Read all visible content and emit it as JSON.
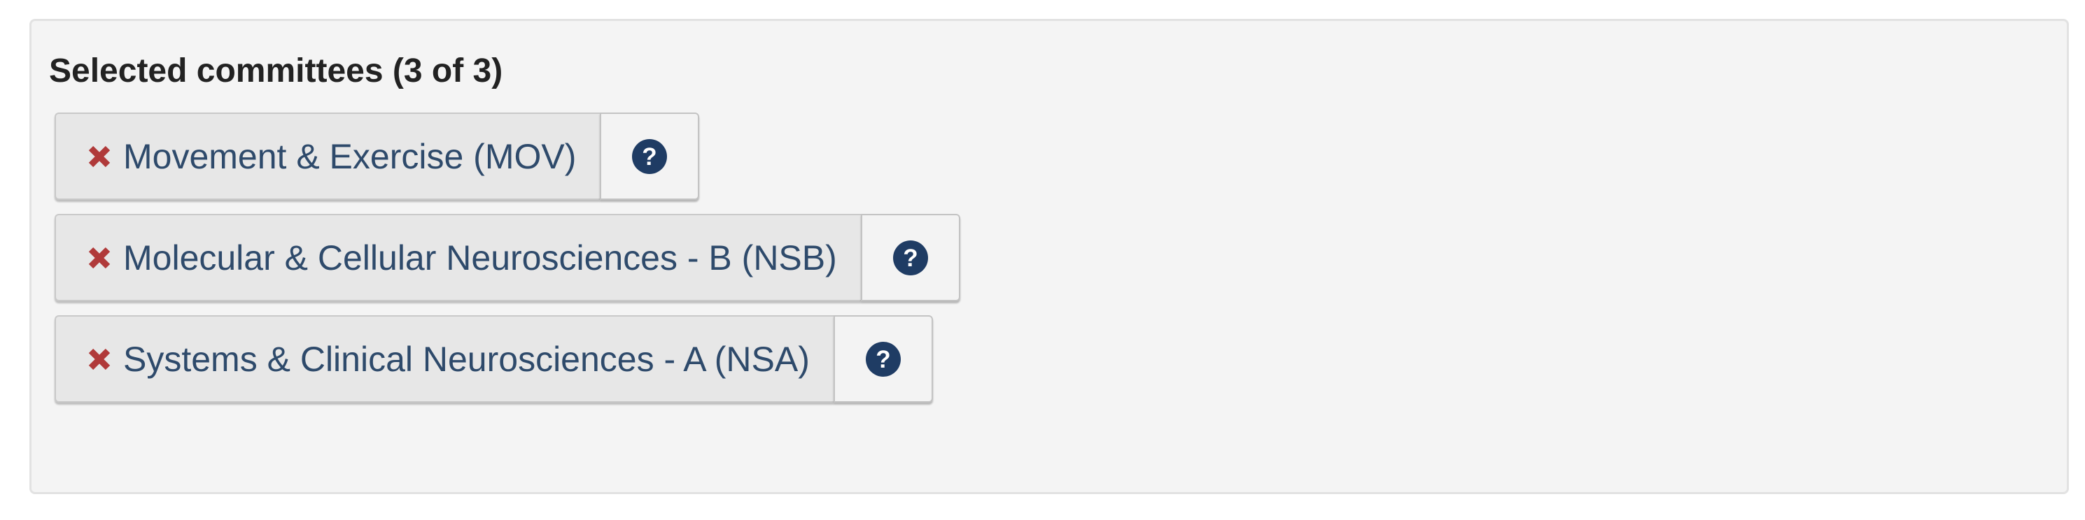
{
  "panel": {
    "heading": "Selected committees (3 of 3)"
  },
  "committees": [
    {
      "label": "Movement & Exercise (MOV)"
    },
    {
      "label": "Molecular & Cellular Neurosciences - B (NSB)"
    },
    {
      "label": "Systems & Clinical Neurosciences - A (NSA)"
    }
  ],
  "icons": {
    "remove": "close-icon",
    "help": "question-circle-icon"
  },
  "colors": {
    "remove_icon": "#b03a3a",
    "help_icon": "#1f3c64",
    "label_text": "#2e4a6b"
  }
}
